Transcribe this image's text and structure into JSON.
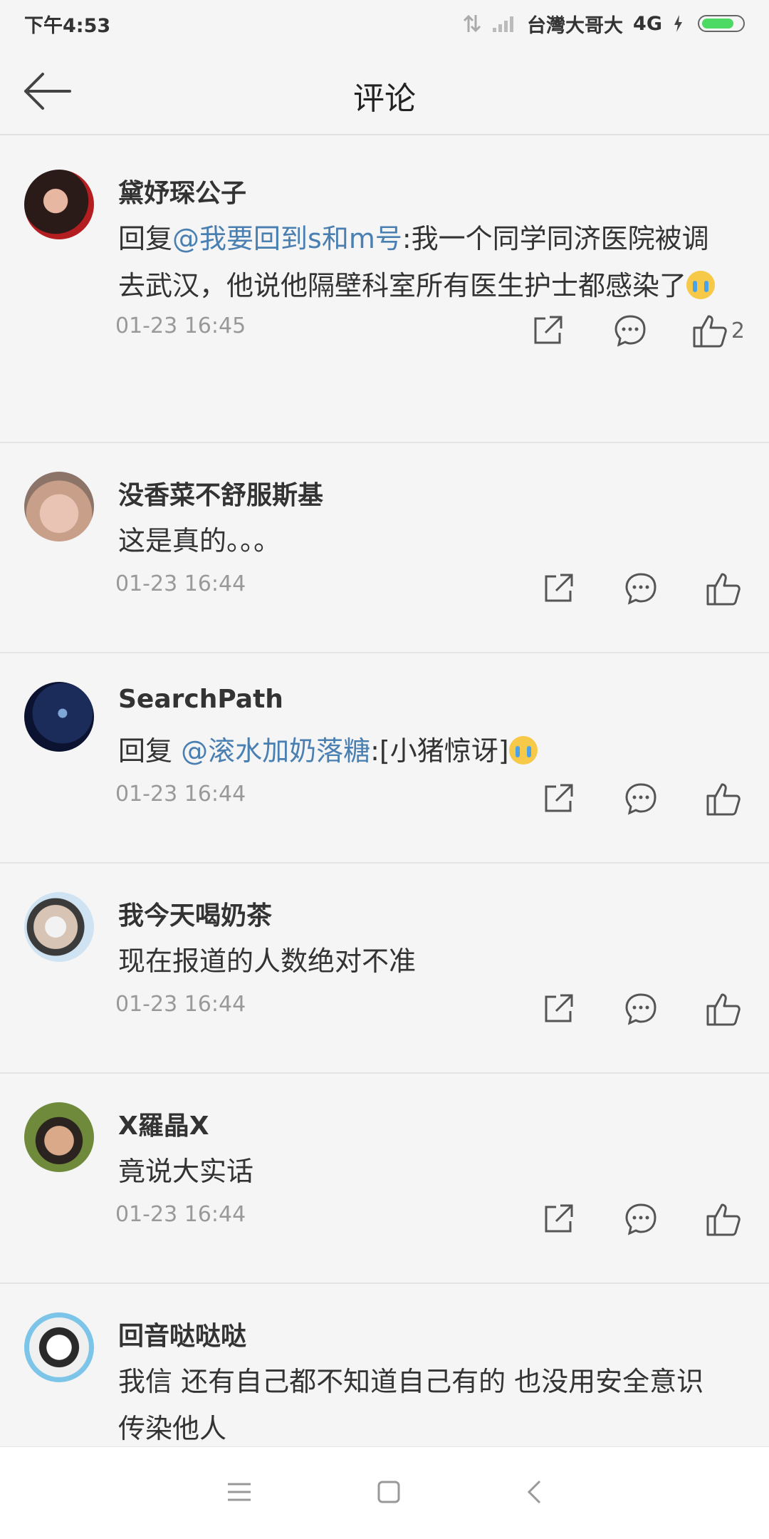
{
  "status": {
    "time": "下午4:53",
    "carrier": "台灣大哥大",
    "network": "4G"
  },
  "header": {
    "title": "评论"
  },
  "comments": [
    {
      "user": "黛妤琛公子",
      "prefix": "回复",
      "mention": "@我要回到s和m号",
      "text": ":我一个同学同济医院被调去武汉，他说他隔壁科室所有医生护士都感染了",
      "emoji": "cry-emoji",
      "time": "01-23 16:45",
      "likes": "2"
    },
    {
      "user": "没香菜不舒服斯基",
      "prefix": "",
      "mention": "",
      "text": "这是真的。。。",
      "emoji": "",
      "time": "01-23 16:44",
      "likes": ""
    },
    {
      "user": "SearchPath",
      "prefix": "回复 ",
      "mention": "@滚水加奶落糖",
      "text": ":[小猪惊讶]",
      "emoji": "cry-emoji",
      "time": "01-23 16:44",
      "likes": ""
    },
    {
      "user": "我今天喝奶茶",
      "prefix": "",
      "mention": "",
      "text": "现在报道的人数绝对不准",
      "emoji": "",
      "time": "01-23 16:44",
      "likes": ""
    },
    {
      "user": "X羅晶X",
      "prefix": "",
      "mention": "",
      "text": "竟说大实话",
      "emoji": "",
      "time": "01-23 16:44",
      "likes": ""
    },
    {
      "user": "回音哒哒哒",
      "prefix": "",
      "mention": "",
      "text": "我信 还有自己都不知道自己有的 也没用安全意识 传染他人",
      "emoji": "",
      "time": "",
      "likes": ""
    }
  ],
  "colors": {
    "mention": "#4a7fb2",
    "background": "#f5f5f6"
  }
}
